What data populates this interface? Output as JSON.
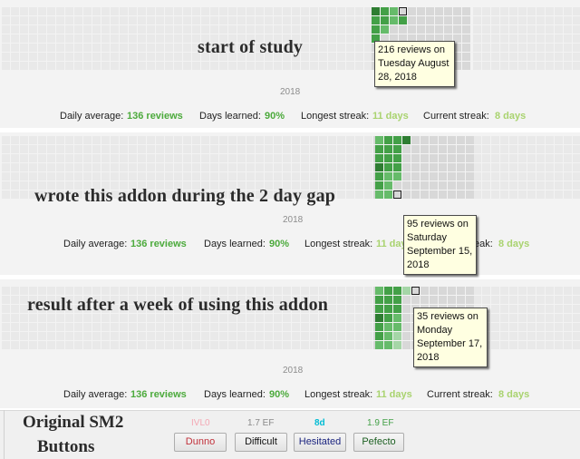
{
  "panels": [
    {
      "caption": "start of study",
      "year": "2018",
      "stats": {
        "daily_average_label": "Daily average:",
        "daily_average_value": "136 reviews",
        "days_learned_label": "Days learned:",
        "days_learned_value": "90%",
        "longest_streak_label": "Longest streak:",
        "longest_streak_value": "11 days",
        "current_streak_label": "Current streak:",
        "current_streak_value": "8 days"
      },
      "tooltip": {
        "line1": "216 reviews on",
        "line2": "Tuesday August",
        "line3": "28, 2018"
      }
    },
    {
      "caption": "wrote this addon during the 2 day gap",
      "year": "2018",
      "stats": {
        "daily_average_label": "Daily average:",
        "daily_average_value": "136 reviews",
        "days_learned_label": "Days learned:",
        "days_learned_value": "90%",
        "longest_streak_label": "Longest streak:",
        "longest_streak_value": "11 days",
        "current_streak_label": "Current streak:",
        "current_streak_value": "8 days"
      },
      "tooltip": {
        "line1": "95 reviews on",
        "line2": "Saturday",
        "line3": "September 15,",
        "line4": "2018"
      }
    },
    {
      "caption": "result after a week of using this addon",
      "year": "2018",
      "stats": {
        "daily_average_label": "Daily average:",
        "daily_average_value": "136 reviews",
        "days_learned_label": "Days learned:",
        "days_learned_value": "90%",
        "longest_streak_label": "Longest streak:",
        "longest_streak_value": "11 days",
        "current_streak_label": "Current streak:",
        "current_streak_value": "8 days"
      },
      "tooltip": {
        "line1": "35 reviews on",
        "line2": "Monday",
        "line3": "September 17,",
        "line4": "2018"
      }
    }
  ],
  "bottom": {
    "title_line1": "Original SM2",
    "title_line2": "Buttons",
    "buttons": [
      {
        "top_text": "IVL0",
        "label": "Dunno",
        "top_color": "#f4a8b4",
        "label_color": "#c0303a"
      },
      {
        "top_text": "1.7 EF",
        "label": "Difficult",
        "top_color": "#8a8a8a",
        "label_color": "#111111"
      },
      {
        "top_text": "8d",
        "label": "Hesitated",
        "top_color": "#00bcd4",
        "label_color": "#1a237e"
      },
      {
        "top_text": "1.9 EF",
        "label": "Pefecto",
        "top_color": "#43a047",
        "label_color": "#1b5e20"
      }
    ]
  },
  "colors": {
    "panel_bg": "#f3f3f3",
    "empty_cell": "#e9e9e9",
    "future_cell": "#d8d8d8",
    "green_dark": "#2e7d32",
    "green_mid": "#43a047",
    "green": "#66bb6a",
    "green_light": "#a5d6a7",
    "selected_border": "#1b1b1b"
  }
}
